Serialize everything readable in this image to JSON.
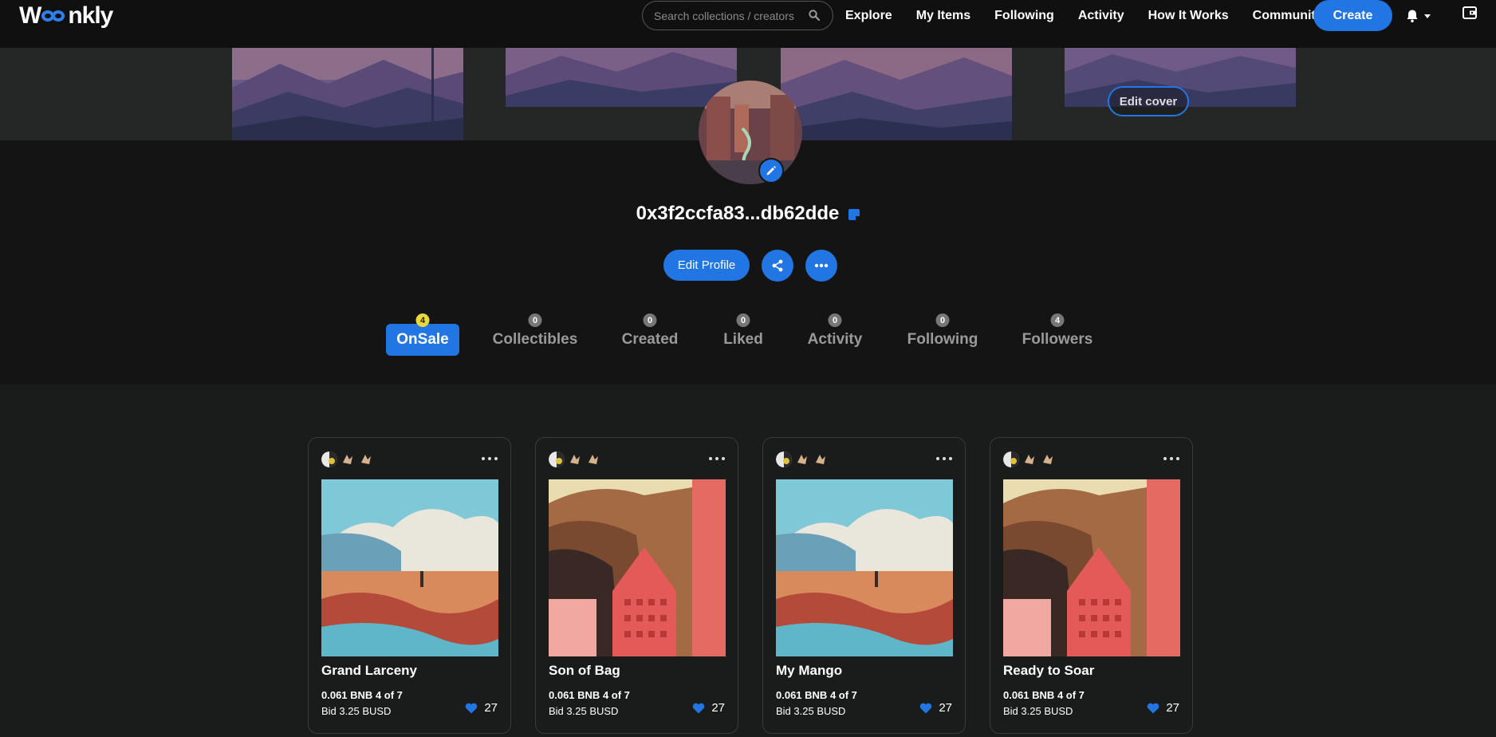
{
  "brand": {
    "logo_start": "W",
    "logo_end": "nkly",
    "accent": "#2276e4"
  },
  "search": {
    "placeholder": "Search collections / creators"
  },
  "nav": {
    "links": [
      "Explore",
      "My Items",
      "Following",
      "Activity",
      "How It Works"
    ],
    "community": "Community",
    "create": "Create"
  },
  "cover": {
    "edit_label": "Edit cover"
  },
  "profile": {
    "address": "0x3f2ccfa83...db62dde",
    "edit_label": "Edit Profile"
  },
  "tabs": [
    {
      "label": "OnSale",
      "count": "4"
    },
    {
      "label": "Collectibles",
      "count": "0"
    },
    {
      "label": "Created",
      "count": "0"
    },
    {
      "label": "Liked",
      "count": "0"
    },
    {
      "label": "Activity",
      "count": "0"
    },
    {
      "label": "Following",
      "count": "0"
    },
    {
      "label": "Followers",
      "count": "4"
    }
  ],
  "cards": [
    {
      "title": "Grand Larceny",
      "price": "0.061 BNB",
      "edition": "4 of 7",
      "bid": "Bid 3.25 BUSD",
      "likes": "27"
    },
    {
      "title": "Son of Bag",
      "price": "0.061 BNB",
      "edition": "4 of 7",
      "bid": "Bid 3.25 BUSD",
      "likes": "27"
    },
    {
      "title": "My Mango",
      "price": "0.061 BNB",
      "edition": "4 of 7",
      "bid": "Bid 3.25 BUSD",
      "likes": "27"
    },
    {
      "title": "Ready to Soar",
      "price": "0.061 BNB",
      "edition": "4 of 7",
      "bid": "Bid 3.25 BUSD",
      "likes": "27"
    }
  ]
}
